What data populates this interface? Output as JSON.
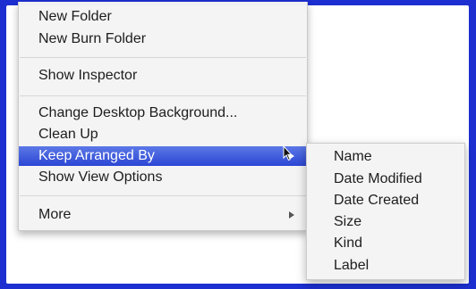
{
  "context_menu": {
    "items": [
      {
        "label": "New Folder"
      },
      {
        "label": "New Burn Folder"
      },
      {
        "label": "Show Inspector"
      },
      {
        "label": "Change Desktop Background..."
      },
      {
        "label": "Clean Up"
      },
      {
        "label": "Keep Arranged By",
        "highlighted": true
      },
      {
        "label": "Show View Options"
      },
      {
        "label": "More"
      }
    ]
  },
  "submenu": {
    "items": [
      {
        "label": "Name"
      },
      {
        "label": "Date Modified"
      },
      {
        "label": "Date Created"
      },
      {
        "label": "Size"
      },
      {
        "label": "Kind"
      },
      {
        "label": "Label"
      }
    ]
  },
  "colors": {
    "desktop": "#1d2fd0",
    "highlight": "#2b46d4",
    "menu_background": "#f4f4f4"
  },
  "icons": {
    "submenu_arrow": "triangle-right-icon",
    "pointer": "mouse-pointer-icon"
  }
}
